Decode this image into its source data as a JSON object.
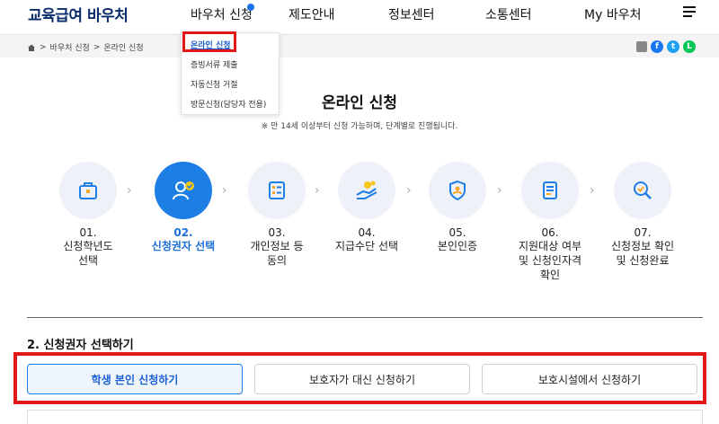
{
  "header": {
    "logo": "교육급여 바우처",
    "nav": [
      "바우처 신청",
      "제도안내",
      "정보센터",
      "소통센터",
      "My 바우처"
    ]
  },
  "dropdown": {
    "items": [
      "온라인 신청",
      "증빙서류 제출",
      "자동신청 거절",
      "방문신청(담당자 전용)"
    ],
    "active_index": 0
  },
  "breadcrumb": {
    "items": [
      "바우처 신청",
      "온라인 신청"
    ],
    "separator": ">"
  },
  "share": {
    "icons": [
      "print-icon",
      "facebook-icon",
      "twitter-icon",
      "line-icon"
    ]
  },
  "page": {
    "title": "온라인 신청",
    "subtitle": "※ 만 14세 이상부터 신청 가능하며, 단계별로 진행됩니다."
  },
  "steps": [
    {
      "num": "01.",
      "label_lines": [
        "신청학년도",
        "선택"
      ],
      "icon": "school-bag-icon",
      "active": false
    },
    {
      "num": "02.",
      "label_lines": [
        "신청권자 선택"
      ],
      "icon": "user-check-icon",
      "active": true
    },
    {
      "num": "03.",
      "label_lines": [
        "개인정보 등",
        "동의"
      ],
      "icon": "form-check-icon",
      "active": false
    },
    {
      "num": "04.",
      "label_lines": [
        "지급수단 선택"
      ],
      "icon": "hand-coin-icon",
      "active": false
    },
    {
      "num": "05.",
      "label_lines": [
        "본인인증"
      ],
      "icon": "shield-user-icon",
      "active": false
    },
    {
      "num": "06.",
      "label_lines": [
        "지원대상 여부",
        "및 신청인자격",
        "확인"
      ],
      "icon": "document-icon",
      "active": false
    },
    {
      "num": "07.",
      "label_lines": [
        "신청정보 확인",
        "및 신청완료"
      ],
      "icon": "search-check-icon",
      "active": false
    }
  ],
  "section": {
    "title": "2. 신청권자 선택하기",
    "options": [
      "학생 본인 신청하기",
      "보호자가 대신 신청하기",
      "보호시설에서 신청하기"
    ],
    "selected_index": 0
  },
  "colors": {
    "primary": "#1d7fe6",
    "logo": "#0b2c6b",
    "highlight": "#e01818"
  }
}
